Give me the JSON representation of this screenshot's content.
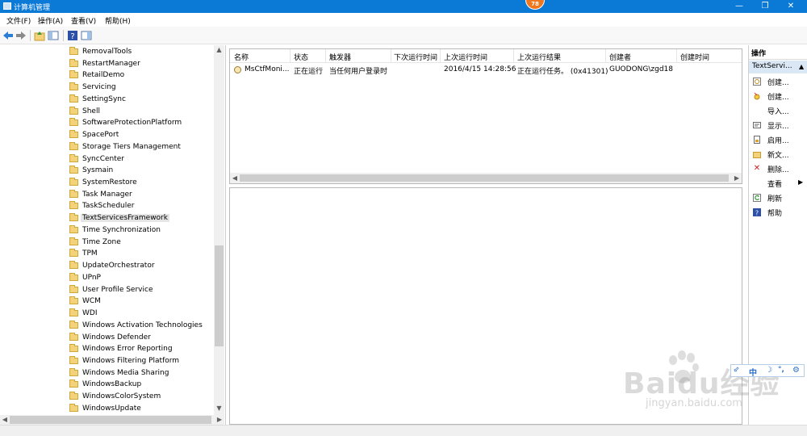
{
  "window": {
    "title": "计算机管理",
    "badge": "78",
    "controls": [
      "—",
      "❐",
      "✕"
    ]
  },
  "menu": [
    "文件(F)",
    "操作(A)",
    "查看(V)",
    "帮助(H)"
  ],
  "tree": {
    "items": [
      {
        "label": "RemovalTools"
      },
      {
        "label": "RestartManager"
      },
      {
        "label": "RetailDemo"
      },
      {
        "label": "Servicing"
      },
      {
        "label": "SettingSync"
      },
      {
        "label": "Shell"
      },
      {
        "label": "SoftwareProtectionPlatform"
      },
      {
        "label": "SpacePort"
      },
      {
        "label": "Storage Tiers Management"
      },
      {
        "label": "SyncCenter"
      },
      {
        "label": "Sysmain"
      },
      {
        "label": "SystemRestore"
      },
      {
        "label": "Task Manager"
      },
      {
        "label": "TaskScheduler"
      },
      {
        "label": "TextServicesFramework",
        "selected": true
      },
      {
        "label": "Time Synchronization"
      },
      {
        "label": "Time Zone"
      },
      {
        "label": "TPM"
      },
      {
        "label": "UpdateOrchestrator"
      },
      {
        "label": "UPnP"
      },
      {
        "label": "User Profile Service"
      },
      {
        "label": "WCM"
      },
      {
        "label": "WDI"
      },
      {
        "label": "Windows Activation Technologies"
      },
      {
        "label": "Windows Defender"
      },
      {
        "label": "Windows Error Reporting"
      },
      {
        "label": "Windows Filtering Platform"
      },
      {
        "label": "Windows Media Sharing"
      },
      {
        "label": "WindowsBackup"
      },
      {
        "label": "WindowsColorSystem"
      },
      {
        "label": "WindowsUpdate"
      }
    ]
  },
  "task_table": {
    "columns": [
      "名称",
      "状态",
      "触发器",
      "下次运行时间",
      "上次运行时间",
      "上次运行结果",
      "创建者",
      "创建时间"
    ],
    "rows": [
      [
        "MsCtfMoni...",
        "正在运行",
        "当任何用户登录时",
        "",
        "2016/4/15 14:28:56",
        "正在运行任务。 (0x41301)",
        "GUODONG\\zgd18",
        ""
      ]
    ]
  },
  "actions": {
    "header": "操作",
    "section": "TextServi...",
    "items": [
      {
        "label": "创建...",
        "icon": "create-basic-task-icon"
      },
      {
        "label": "创建...",
        "icon": "create-task-icon"
      },
      {
        "label": "导入...",
        "icon": ""
      },
      {
        "label": "显示...",
        "icon": "display-running-tasks-icon"
      },
      {
        "label": "启用...",
        "icon": "enable-history-icon"
      },
      {
        "label": "新文...",
        "icon": "new-folder-icon"
      },
      {
        "label": "删除...",
        "icon": "delete-icon"
      },
      {
        "label": "查看",
        "icon": "",
        "submenu": true
      },
      {
        "label": "刷新",
        "icon": "refresh-icon"
      },
      {
        "label": "帮助",
        "icon": "help-icon"
      }
    ]
  },
  "ime": {
    "mode": "中"
  },
  "watermark": {
    "text": "Baidu经验",
    "sub": "jingyan.baidu.com"
  }
}
